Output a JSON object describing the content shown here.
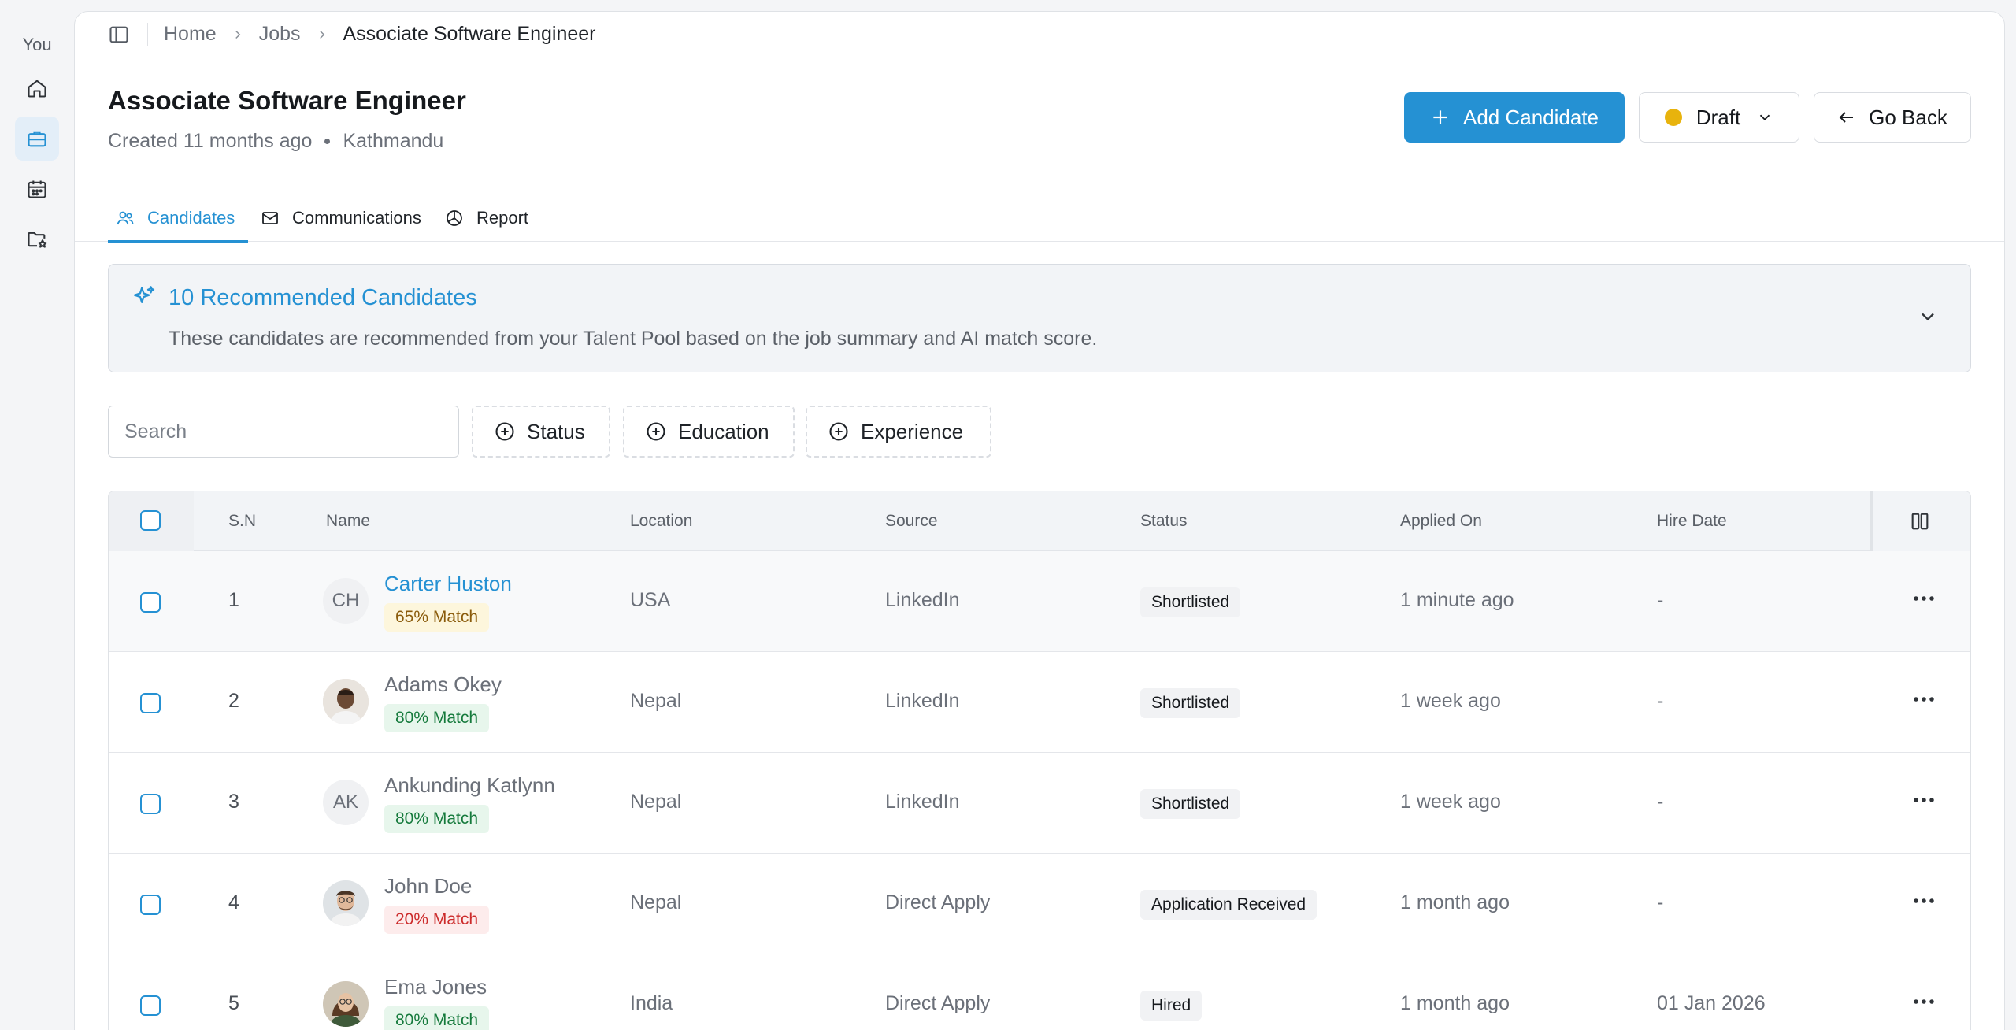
{
  "rail": {
    "user_label": "You"
  },
  "breadcrumb": {
    "home": "Home",
    "jobs": "Jobs",
    "current": "Associate Software Engineer"
  },
  "job": {
    "title": "Associate Software Engineer",
    "created": "Created 11 months ago",
    "location": "Kathmandu"
  },
  "actions": {
    "add_candidate": "Add Candidate",
    "status": "Draft",
    "status_color": "#e8b30d",
    "go_back": "Go Back"
  },
  "tabs": [
    {
      "label": "Candidates",
      "icon": "users-icon",
      "active": true
    },
    {
      "label": "Communications",
      "icon": "mail-icon",
      "active": false
    },
    {
      "label": "Report",
      "icon": "pie-chart-icon",
      "active": false
    }
  ],
  "recommendation": {
    "title": "10 Recommended Candidates",
    "description": "These candidates are recommended from your Talent Pool based on the job summary and AI match score."
  },
  "filters": {
    "search_placeholder": "Search",
    "status": "Status",
    "education": "Education",
    "experience": "Experience"
  },
  "table": {
    "headers": {
      "sn": "S.N",
      "name": "Name",
      "location": "Location",
      "source": "Source",
      "status": "Status",
      "applied_on": "Applied On",
      "hire_date": "Hire Date"
    },
    "rows": [
      {
        "sn": "1",
        "initials": "CH",
        "name": "Carter Huston",
        "match": "65% Match",
        "location": "USA",
        "source": "LinkedIn",
        "status": "Shortlisted",
        "applied_on": "1 minute ago",
        "hire_date": "-"
      },
      {
        "sn": "2",
        "initials": "",
        "name": "Adams Okey",
        "match": "80% Match",
        "location": "Nepal",
        "source": "LinkedIn",
        "status": "Shortlisted",
        "applied_on": "1 week ago",
        "hire_date": "-"
      },
      {
        "sn": "3",
        "initials": "AK",
        "name": "Ankunding Katlynn",
        "match": "80% Match",
        "location": "Nepal",
        "source": "LinkedIn",
        "status": "Shortlisted",
        "applied_on": "1 week ago",
        "hire_date": "-"
      },
      {
        "sn": "4",
        "initials": "",
        "name": "John Doe",
        "match": "20% Match",
        "location": "Nepal",
        "source": "Direct Apply",
        "status": "Application Received",
        "applied_on": "1 month ago",
        "hire_date": "-"
      },
      {
        "sn": "5",
        "initials": "",
        "name": "Ema Jones",
        "match": "80% Match",
        "location": "India",
        "source": "Direct Apply",
        "status": "Hired",
        "applied_on": "1 month ago",
        "hire_date": "01 Jan 2026"
      }
    ]
  },
  "colors": {
    "accent": "#2591d3",
    "match_high": "#157a3c",
    "match_mid": "#8a5b0b",
    "match_low": "#cc2b2b"
  }
}
